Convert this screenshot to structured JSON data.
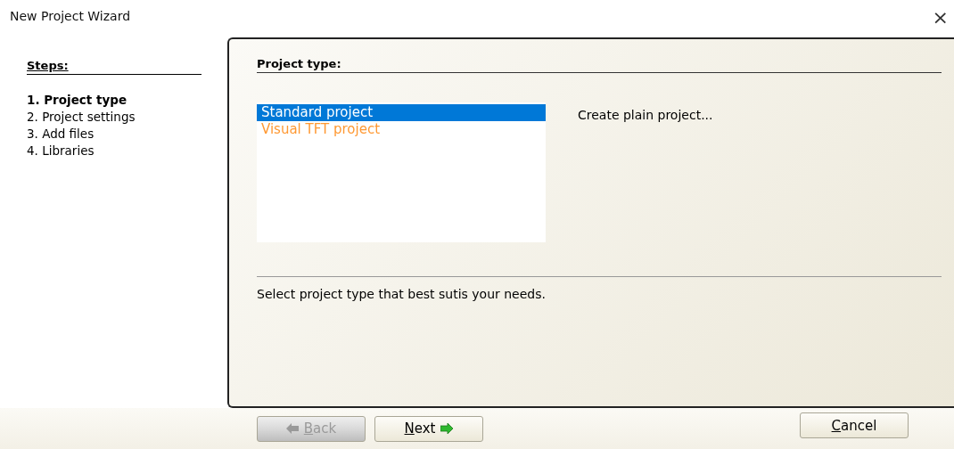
{
  "window": {
    "title": "New Project Wizard",
    "close": "×"
  },
  "steps": {
    "heading": "Steps:",
    "items": [
      {
        "label": "1. Project type",
        "selected": true
      },
      {
        "label": "2. Project settings",
        "selected": false
      },
      {
        "label": "3. Add files",
        "selected": false
      },
      {
        "label": "4. Libraries",
        "selected": false
      }
    ]
  },
  "panel": {
    "heading": "Project type:",
    "project_types": [
      {
        "label": "Standard project",
        "selected": true,
        "kind": "plain"
      },
      {
        "label": "Visual TFT project",
        "selected": false,
        "kind": "highlighted"
      }
    ],
    "description": "Create plain project...",
    "hint": "Select project type that best sutis your needs."
  },
  "buttons": [
    {
      "kind": "back",
      "label": "Back",
      "disabled": true
    },
    {
      "kind": "next",
      "label": "Next",
      "disabled": false
    },
    {
      "kind": "cancel",
      "label": "Cancel",
      "disabled": false
    }
  ]
}
